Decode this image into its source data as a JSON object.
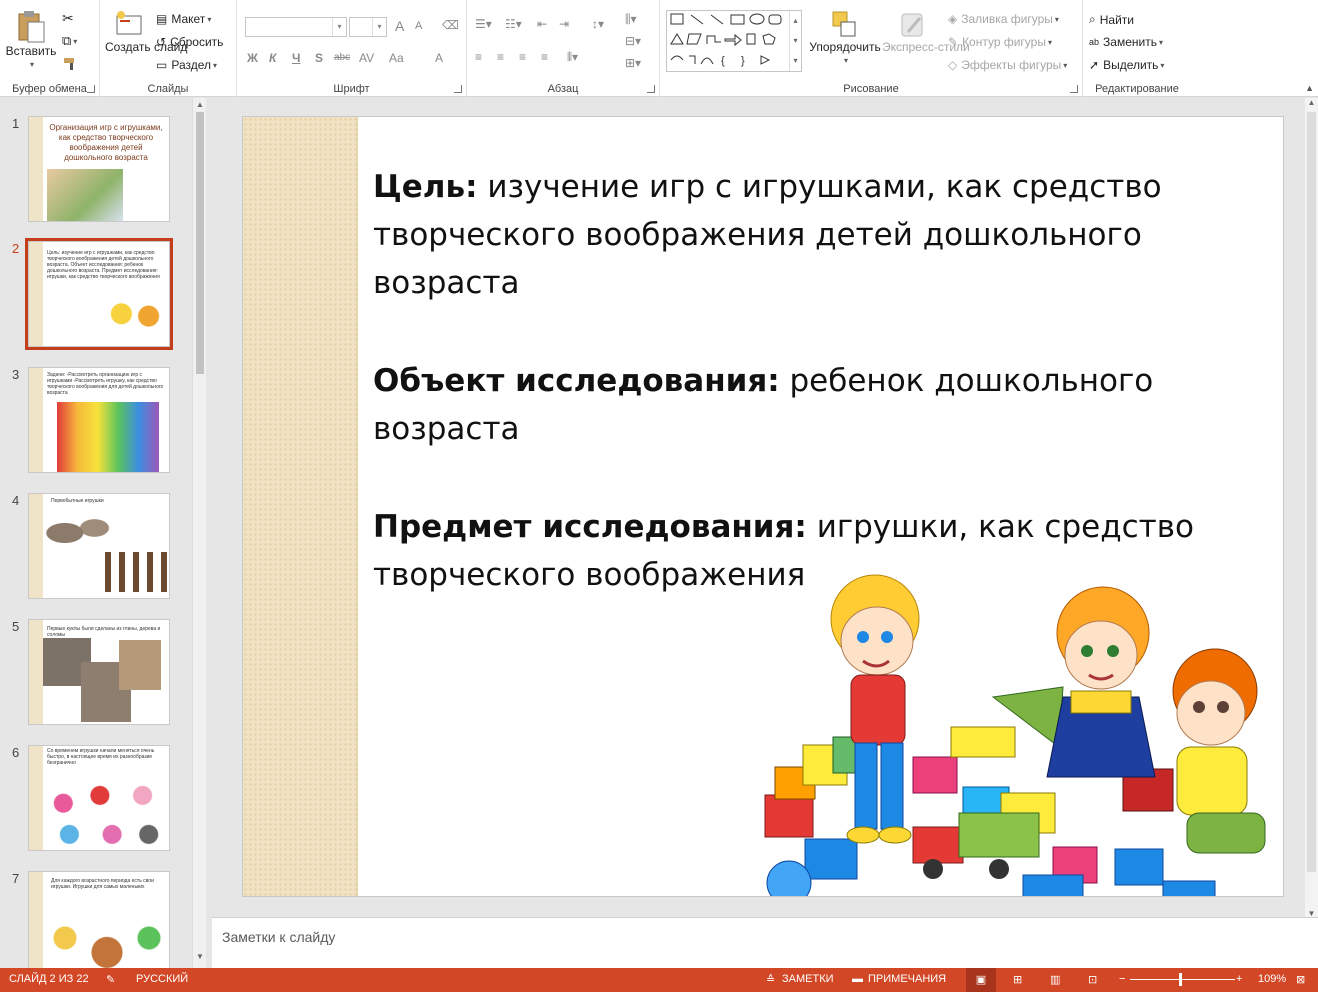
{
  "ribbon": {
    "clipboard": {
      "paste": "Вставить",
      "label": "Буфер обмена"
    },
    "slides": {
      "new_slide": "Создать слайд",
      "layout": "Макет",
      "reset": "Сбросить",
      "section": "Раздел",
      "label": "Слайды"
    },
    "font": {
      "label": "Шрифт",
      "bold": "Ж",
      "italic": "К",
      "underline": "Ч",
      "shadow": "S",
      "strike": "abc",
      "spacing": "AV",
      "case": "Aa",
      "color": "A",
      "grow": "A",
      "shrink": "A"
    },
    "paragraph": {
      "label": "Абзац"
    },
    "drawing": {
      "arrange": "Упорядочить",
      "quick_styles": "Экспресс-стили",
      "fill": "Заливка фигуры",
      "outline": "Контур фигуры",
      "effects": "Эффекты фигуры",
      "label": "Рисование"
    },
    "editing": {
      "find": "Найти",
      "replace": "Заменить",
      "select": "Выделить",
      "label": "Редактирование"
    }
  },
  "thumbnails": [
    {
      "num": "1",
      "text": "Организация игр с игрушками, как средство творческого воображения детей дошкольного возраста"
    },
    {
      "num": "2",
      "text": "Цель: изучение игр с игрушками, как средство творческого воображения детей дошкольного возраста. Объект исследования: ребенок дошкольного возраста. Предмет исследования: игрушки, как средство творческого воображения"
    },
    {
      "num": "3",
      "text": "Задачи: -Рассмотреть организацию игр с игрушками -Рассмотреть игрушку, как средство творческого воображения для детей дошкольного возраста"
    },
    {
      "num": "4",
      "text": "Первобытные игрушки"
    },
    {
      "num": "5",
      "text": "Первые куклы были сделаны из глины, дерева и соломы"
    },
    {
      "num": "6",
      "text": "Со временем игрушки начали меняться очень быстро, в настоящее время их разнообразие безгранично"
    },
    {
      "num": "7",
      "text": "Для каждого возрастного периода есть свои игрушки. Игрушки для самых маленьких"
    }
  ],
  "slide": {
    "goal_label": "Цель:",
    "goal_text": " изучение игр с игрушками, как средство творческого воображения детей дошкольного возраста",
    "object_label": "Объект исследования:",
    "object_text": " ребенок дошкольного возраста",
    "subject_label": "Предмет исследования:",
    "subject_text": " игрушки, как средство творческого воображения"
  },
  "notes": {
    "placeholder": "Заметки к слайду"
  },
  "status": {
    "slide_info": "СЛАЙД 2 ИЗ 22",
    "language": "РУССКИЙ",
    "notes": "ЗАМЕТКИ",
    "comments": "ПРИМЕЧАНИЯ",
    "zoom": "109%",
    "zoom_level": 0.5
  },
  "colors": {
    "accent": "#d24726",
    "active_thumb": "#c43e1c",
    "bar": "#f0e2c2"
  }
}
